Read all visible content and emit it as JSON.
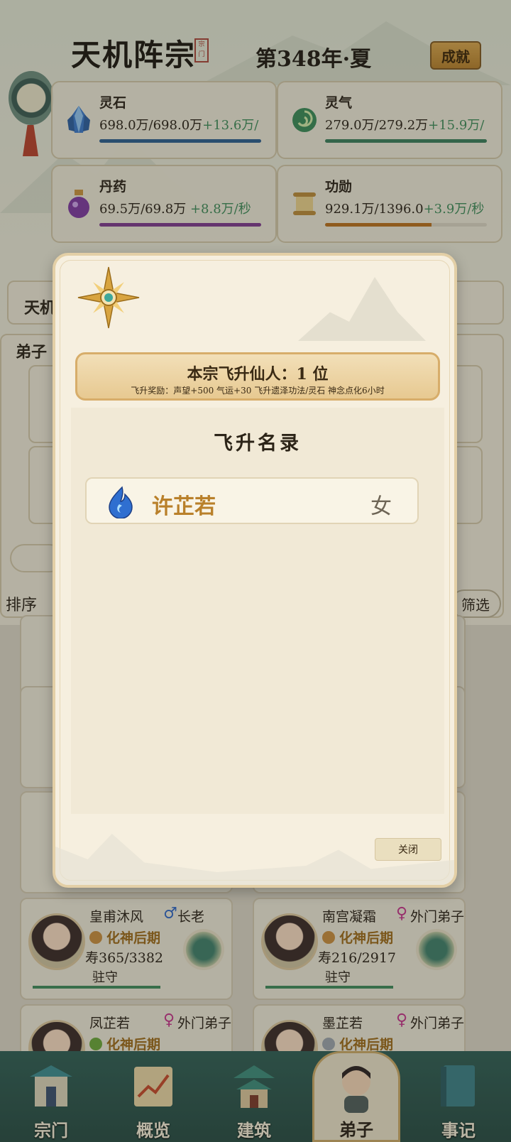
{
  "header": {
    "sect_name": "天机阵宗",
    "seal_text": "宗门",
    "year": "第348年·夏",
    "achievement_button": "成就"
  },
  "resources": [
    {
      "name": "灵石",
      "icon": "spirit-stone-icon",
      "current": "698.0万",
      "max": "698.0万",
      "rate": "+13.6万/",
      "color": "#2c5d8e",
      "fill": 1.0
    },
    {
      "name": "灵气",
      "icon": "spirit-qi-icon",
      "current": "279.0万",
      "max": "279.2万",
      "rate": "+15.9万/",
      "color": "#3a7d5a",
      "fill": 1.0
    },
    {
      "name": "丹药",
      "icon": "elixir-icon",
      "current": "69.5万",
      "max": "69.8万",
      "rate": "+8.8万/秒",
      "color": "#7d3a8e",
      "fill": 1.0
    },
    {
      "name": "功勋",
      "icon": "merit-scroll-icon",
      "current": "929.1万",
      "max": "1396.0",
      "rate": "+3.9万/秒",
      "color": "#b8701e",
      "fill": 0.66
    }
  ],
  "background": {
    "sect_label_fragment": "天机",
    "disciples_label_fragment": "弟子",
    "sort_label": "排序",
    "filter_button": "筛选"
  },
  "disciples": [
    {
      "name": "皇甫沐风",
      "gender": "♂",
      "rank": "长老",
      "realm": "化神后期",
      "lifespan": "寿365/3382",
      "status": "驻守"
    },
    {
      "name": "南宫凝霜",
      "gender": "♀",
      "rank": "外门弟子",
      "realm": "化神后期",
      "lifespan": "寿216/2917",
      "status": "驻守"
    },
    {
      "name": "凤芷若",
      "gender": "♀",
      "rank": "外门弟子",
      "realm": "化神后期",
      "lifespan": "",
      "status": ""
    },
    {
      "name": "墨芷若",
      "gender": "♀",
      "rank": "外门弟子",
      "realm": "化神后期",
      "lifespan": "",
      "status": ""
    }
  ],
  "nav": [
    {
      "label": "宗门",
      "icon": "sect-gate-icon"
    },
    {
      "label": "概览",
      "icon": "overview-chart-icon"
    },
    {
      "label": "建筑",
      "icon": "building-icon"
    },
    {
      "label": "弟子",
      "icon": "disciple-portrait-icon",
      "active": true
    },
    {
      "label": "事记",
      "icon": "chronicle-book-icon"
    }
  ],
  "modal": {
    "banner_title": "本宗飞升仙人：1 位",
    "banner_subtitle": "飞升奖励：声望+500    气运+30    飞升遗泽功法/灵石    神念点化6小时",
    "list_title": "飞升名录",
    "ascended": [
      {
        "name": "许芷若",
        "gender": "女",
        "icon": "blue-flame-icon"
      }
    ],
    "close_button": "关闭"
  }
}
